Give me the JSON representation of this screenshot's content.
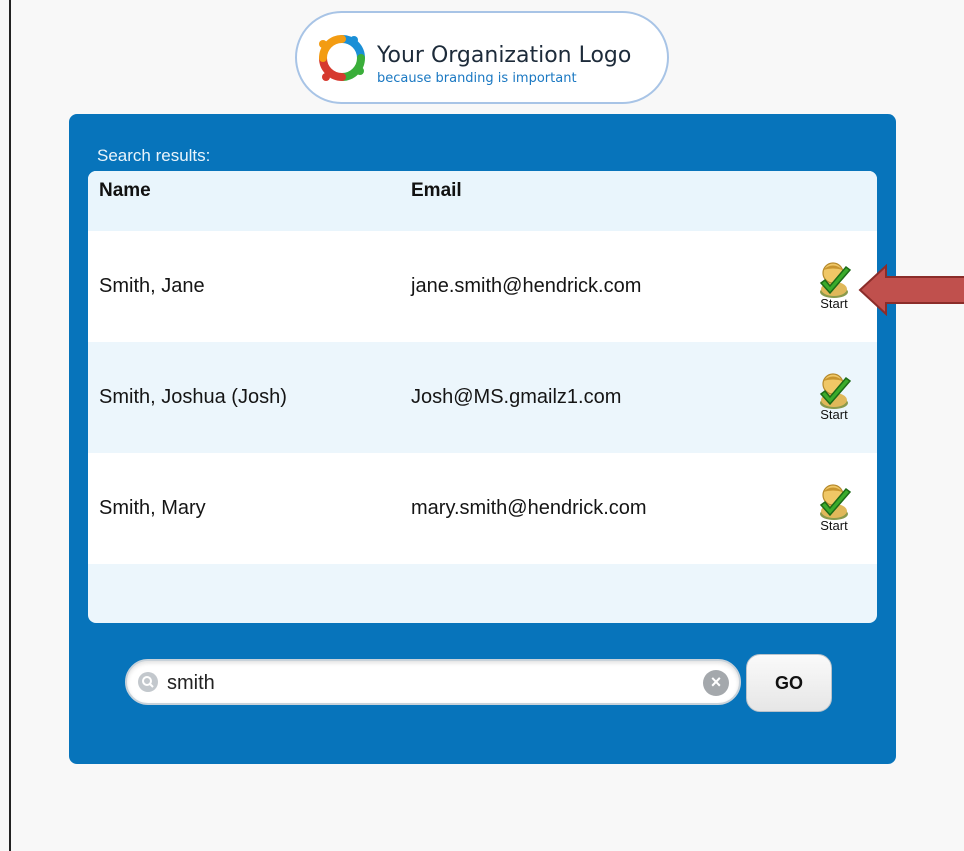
{
  "logo": {
    "title": "Your Organization Logo",
    "tagline": "because branding is important",
    "colors": [
      "#f39c12",
      "#1a8fd6",
      "#3aae3a",
      "#d63a2f"
    ]
  },
  "results": {
    "label": "Search results:",
    "columns": [
      "Name",
      "Email"
    ],
    "rows": [
      {
        "name": "Smith, Jane",
        "email": "jane.smith@hendrick.com",
        "action": "Start"
      },
      {
        "name": "Smith, Joshua (Josh)",
        "email": "Josh@MS.gmailz1.com",
        "action": "Start"
      },
      {
        "name": "Smith, Mary",
        "email": "mary.smith@hendrick.com",
        "action": "Start"
      }
    ]
  },
  "search": {
    "value": "smith",
    "go_label": "GO",
    "icons": {
      "search": "search-icon",
      "clear": "clear-icon"
    }
  },
  "annotation": {
    "arrow": "arrow-pointing-left",
    "color": "#c0504d"
  },
  "colors": {
    "panel": "#0774bb",
    "row_alt": "#ecf6fc"
  }
}
